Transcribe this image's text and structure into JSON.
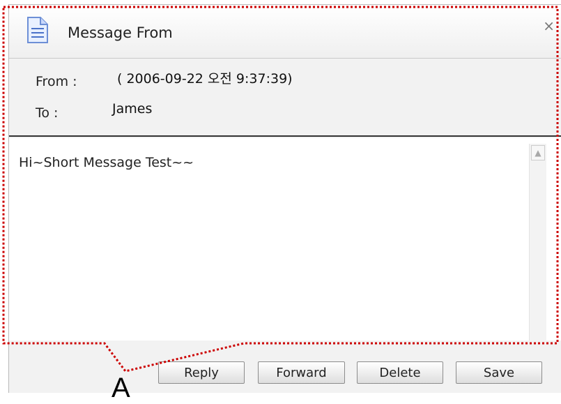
{
  "window": {
    "title": "Message From",
    "close_symbol": "×"
  },
  "header": {
    "from_label": "From :",
    "from_value": "( 2006-09-22 오전 9:37:39)",
    "to_label": "To :",
    "to_value": "James"
  },
  "message": {
    "body": "Hi~Short Message Test~~"
  },
  "buttons": {
    "reply": "Reply",
    "forward": "Forward",
    "delete": "Delete",
    "save": "Save"
  },
  "annotation": {
    "label": "A",
    "color": "#cc0000"
  },
  "icons": {
    "title_icon": "document-icon",
    "close_icon": "close-icon",
    "scroll_up_icon": "scroll-up-arrow-icon"
  }
}
